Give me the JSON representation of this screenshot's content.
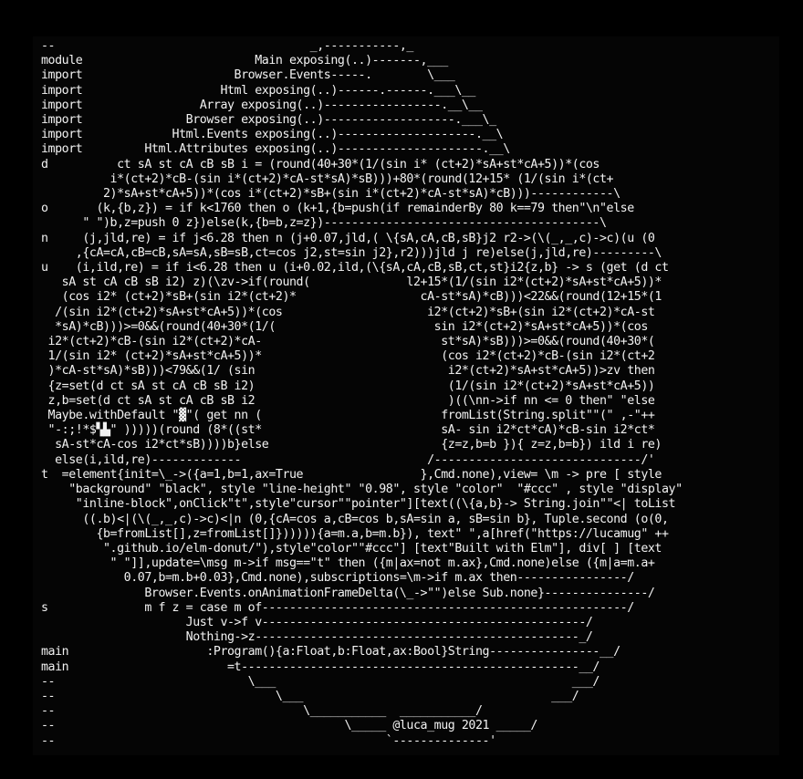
{
  "code": {
    "lines": [
      "--                                     _,-----------,_",
      "module                         Main exposing(..)-------,___",
      "import                      Browser.Events-----.        \\___",
      "import                    Html exposing(..)------.------.___\\__",
      "import                 Array exposing(..)-----------------.__\\__",
      "import               Browser exposing(..)-------------------.___\\_",
      "import             Html.Events exposing(..)--------------------.__\\",
      "import         Html.Attributes exposing(..)---------------------.__\\",
      "d          ct sA st cA cB sB i = (round(40+30*(1/(sin i* (ct+2)*sA+st*cA+5))*(cos",
      "          i*(ct+2)*cB-(sin i*(ct+2)*cA-st*sA)*sB)))+80*(round(12+15* (1/(sin i*(ct+",
      "         2)*sA+st*cA+5))*(cos i*(ct+2)*sB+(sin i*(ct+2)*cA-st*sA)*cB)))------------\\",
      "o       (k,{b,z}) = if k<1760 then o (k+1,{b=push(if remainderBy 80 k==79 then\"\\n\"else",
      "      \" \")b,z=push 0 z})else(k,{b=b,z=z})----------------------------------------\\",
      "n     (j,jld,re) = if j<6.28 then n (j+0.07,jld,( \\{sA,cA,cB,sB}j2 r2->(\\(_,_,c)->c)(u (0",
      "     ,{cA=cA,cB=cB,sA=sA,sB=sB,ct=cos j2,st=sin j2},r2)))jld j re)else(j,jld,re)---------\\",
      "u    (i,ild,re) = if i<6.28 then u (i+0.02,ild,(\\{sA,cA,cB,sB,ct,st}i2{z,b} -> s (get (d ct",
      "   sA st cA cB sB i2) z)(\\zv->if(round(              l2+15*(1/(sin i2*(ct+2)*sA+st*cA+5))*",
      "   (cos i2* (ct+2)*sB+(sin i2*(ct+2)*                  cA-st*sA)*cB)))<22&&(round(12+15*(1",
      "  /(sin i2*(ct+2)*sA+st*cA+5))*(cos                     i2*(ct+2)*sB+(sin i2*(ct+2)*cA-st",
      "  *sA)*cB)))>=0&&(round(40+30*(1/(                       sin i2*(ct+2)*sA+st*cA+5))*(cos",
      " i2*(ct+2)*cB-(sin i2*(ct+2)*cA-                          st*sA)*sB)))>=0&&(round(40+30*(",
      " 1/(sin i2* (ct+2)*sA+st*cA+5))*                          (cos i2*(ct+2)*cB-(sin i2*(ct+2",
      " )*cA-st*sA)*sB)))<79&&(1/ (sin                            i2*(ct+2)*sA+st*cA+5))>zv then",
      " {z=set(d ct sA st cA cB sB i2)                            (1/(sin i2*(ct+2)*sA+st*cA+5))",
      " z,b=set(d ct sA st cA cB sB i2                            )((\\nn->if nn <= 0 then\" \"else",
      " Maybe.withDefault \"▓\"( get nn (                          fromList(String.split\"\"(\" ,-\"++",
      " \"-:;!*$▚▙\" )))))(round (8*((st*                          sA- sin i2*ct*cA)*cB-sin i2*ct*",
      "  sA-st*cA-cos i2*ct*sB))))b}else                         {z=z,b=b }){ z=z,b=b}) ild i re)",
      "  else(i,ild,re)-------------                           /------------------------------/'",
      "t  =element{init=\\_->({a=1,b=1,ax=True                 },Cmd.none),view= \\m -> pre [ style",
      "    \"background\" \"black\", style \"line-height\" \"0.98\", style \"color\"  \"#ccc\" , style \"display\"",
      "     \"inline-block\",onClick\"t\",style\"cursor\"\"pointer\"][text((\\{a,b}-> String.join\"\"<| toList",
      "      ((.b)<|(\\(_,_,c)->c)<|n (0,{cA=cos a,cB=cos b,sA=sin a, sB=sin b}, Tuple.second (o(0,",
      "        {b=fromList[],z=fromList[]}))))){a=m.a,b=m.b}), text\" \",a[href(\"https://lucamug\" ++",
      "         \".github.io/elm-donut/\"),style\"color\"\"#ccc\"] [text\"Built with Elm\"], div[ ] [text",
      "          \" \"]],update=\\msg m->if msg==\"t\" then ({m|ax=not m.ax},Cmd.none)else ({m|a=m.a+",
      "            0.07,b=m.b+0.03},Cmd.none),subscriptions=\\m->if m.ax then----------------/",
      "               Browser.Events.onAnimationFrameDelta(\\_->\"\")else Sub.none}---------------/",
      "s              m f z = case m of-----------------------------------------------------/",
      "                     Just v->f v-----------------------------------------------/",
      "                     Nothing->z-----------------------------------------------_/",
      "main                    :Program(){a:Float,b:Float,ax:Bool}String----------------__/",
      "main                       =t-------------------------------------------------__/",
      "--                            \\___                                           ___/",
      "--                                \\___                                    ___/",
      "--                                    \\___________  ___________/",
      "--                                          \\_____ @luca_mug 2021 _____/",
      "--                                                `--------------'"
    ],
    "highlight_chars": [
      "▓",
      "▚",
      "▙"
    ],
    "credit": "@luca_mug 2021",
    "colors": {
      "background": "#000000",
      "text": "#f2f2f2"
    }
  }
}
